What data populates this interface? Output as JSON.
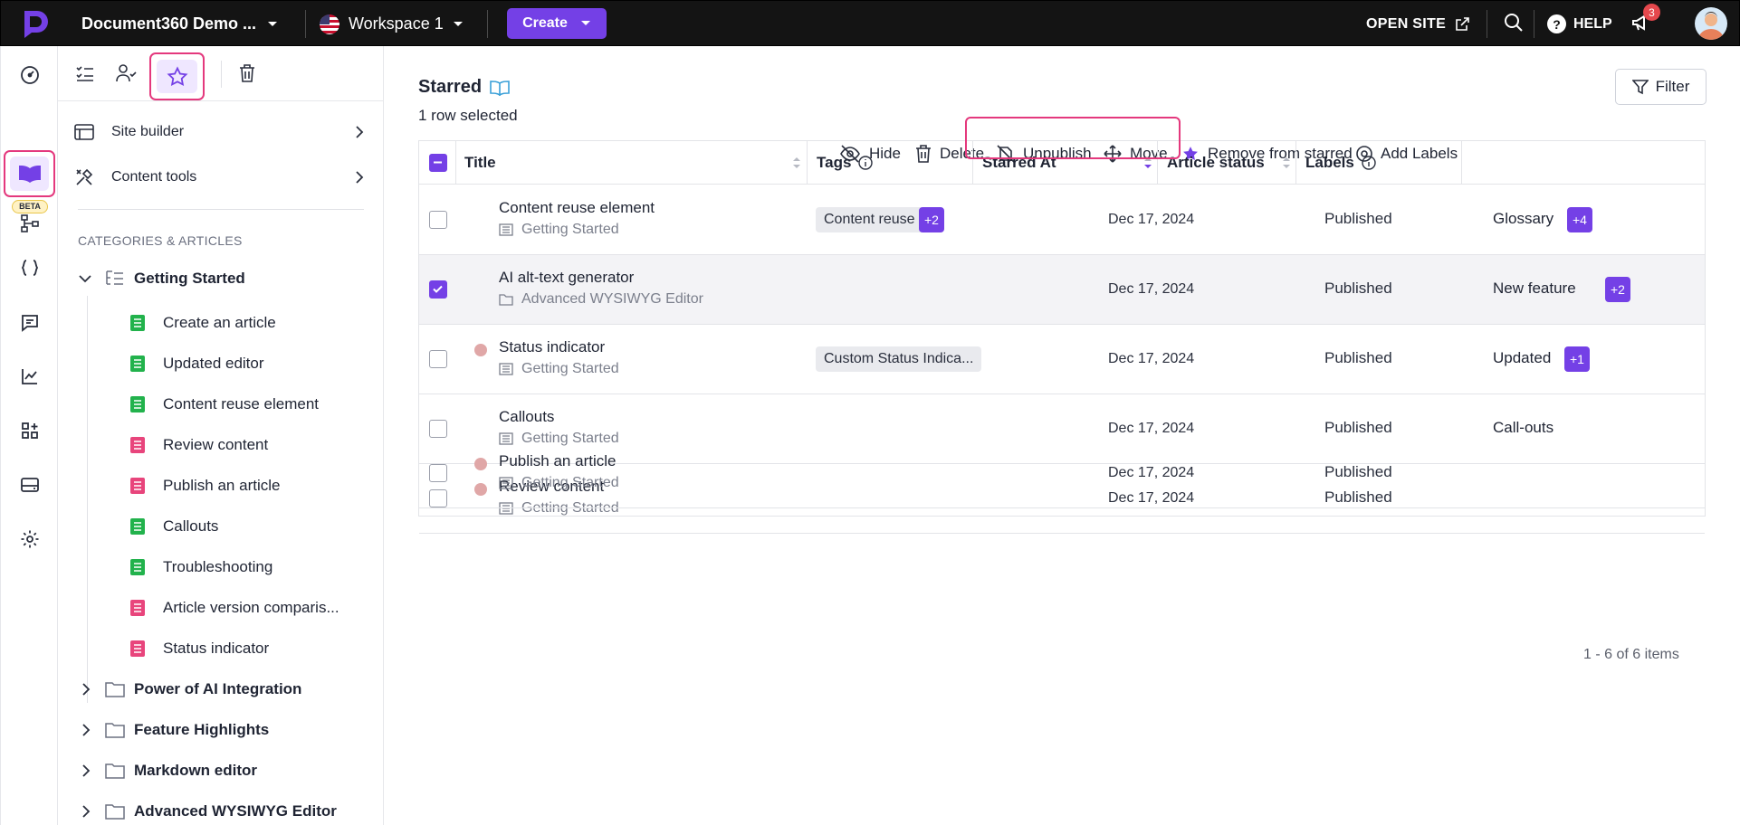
{
  "topbar": {
    "project_name": "Document360 Demo ...",
    "workspace": "Workspace 1",
    "create_label": "Create",
    "open_site_label": "OPEN SITE",
    "help_label": "HELP",
    "notification_count": "3"
  },
  "rail": {
    "beta_label": "BETA",
    "icons": [
      "dashboard-icon",
      "documentation-icon",
      "api-docs-icon",
      "feedback-icon",
      "analytics-icon",
      "integrations-icon",
      "drive-icon",
      "settings-icon"
    ]
  },
  "panel": {
    "nav": [
      {
        "label": "Site builder"
      },
      {
        "label": "Content tools"
      }
    ],
    "categories_heading": "CATEGORIES & ARTICLES",
    "root_category": "Getting Started",
    "articles": [
      {
        "label": "Create an article",
        "status": "published"
      },
      {
        "label": "Updated editor",
        "status": "published"
      },
      {
        "label": "Content reuse element",
        "status": "published"
      },
      {
        "label": "Review content",
        "status": "draft"
      },
      {
        "label": "Publish an article",
        "status": "draft"
      },
      {
        "label": "Callouts",
        "status": "published"
      },
      {
        "label": "Troubleshooting",
        "status": "published"
      },
      {
        "label": "Article version comparis...",
        "status": "draft"
      },
      {
        "label": "Status indicator",
        "status": "draft"
      }
    ],
    "folders": [
      {
        "label": "Power of AI Integration"
      },
      {
        "label": "Feature Highlights"
      },
      {
        "label": "Markdown editor"
      },
      {
        "label": "Advanced WYSIWYG Editor"
      }
    ]
  },
  "main": {
    "title": "Starred",
    "filter_label": "Filter",
    "selection_text": "1 row selected",
    "actions": {
      "hide": "Hide",
      "delete": "Delete",
      "unpublish": "Unpublish",
      "move": "Move",
      "remove_starred": "Remove from starred",
      "add_labels": "Add Labels"
    },
    "columns": {
      "title": "Title",
      "tags": "Tags",
      "starred_at": "Starred At",
      "article_status": "Article status",
      "labels": "Labels"
    },
    "rows": [
      {
        "title": "Content reuse element",
        "location": "Getting Started",
        "location_type": "category",
        "tag": "Content reuse",
        "tag_more": "+2",
        "starred_at": "Dec 17, 2024",
        "status": "Published",
        "label": "Glossary",
        "label_more": "+4",
        "selected": false,
        "dot": false
      },
      {
        "title": "AI alt-text generator",
        "location": "Advanced WYSIWYG Editor",
        "location_type": "folder",
        "tag": "",
        "tag_more": "",
        "starred_at": "Dec 17, 2024",
        "status": "Published",
        "label": "New feature",
        "label_more": "+2",
        "selected": true,
        "dot": false
      },
      {
        "title": "Status indicator",
        "location": "Getting Started",
        "location_type": "category",
        "tag": "Custom Status Indica...",
        "tag_more": "",
        "starred_at": "Dec 17, 2024",
        "status": "Published",
        "label": "Updated",
        "label_more": "+1",
        "selected": false,
        "dot": true
      },
      {
        "title": "Callouts",
        "location": "Getting Started",
        "location_type": "category",
        "tag": "",
        "tag_more": "",
        "starred_at": "Dec 17, 2024",
        "status": "Published",
        "label": "Call-outs",
        "label_more": "",
        "selected": false,
        "dot": false
      },
      {
        "title": "Review content",
        "location": "Getting Started",
        "location_type": "category",
        "tag": "",
        "tag_more": "",
        "starred_at": "Dec 17, 2024",
        "status": "Published",
        "label": "",
        "label_more": "",
        "selected": false,
        "dot": true
      },
      {
        "title": "Publish an article",
        "location": "Getting Started",
        "location_type": "category",
        "tag": "",
        "tag_more": "",
        "starred_at": "Dec 17, 2024",
        "status": "Published",
        "label": "",
        "label_more": "",
        "selected": false,
        "dot": true
      }
    ],
    "pagination": "1 - 6 of 6 items"
  },
  "colors": {
    "accent": "#7440e6",
    "highlight": "#e4387d",
    "published_doc": "#22b24c",
    "draft_doc": "#e8457c",
    "topbar_bg": "#141414"
  }
}
